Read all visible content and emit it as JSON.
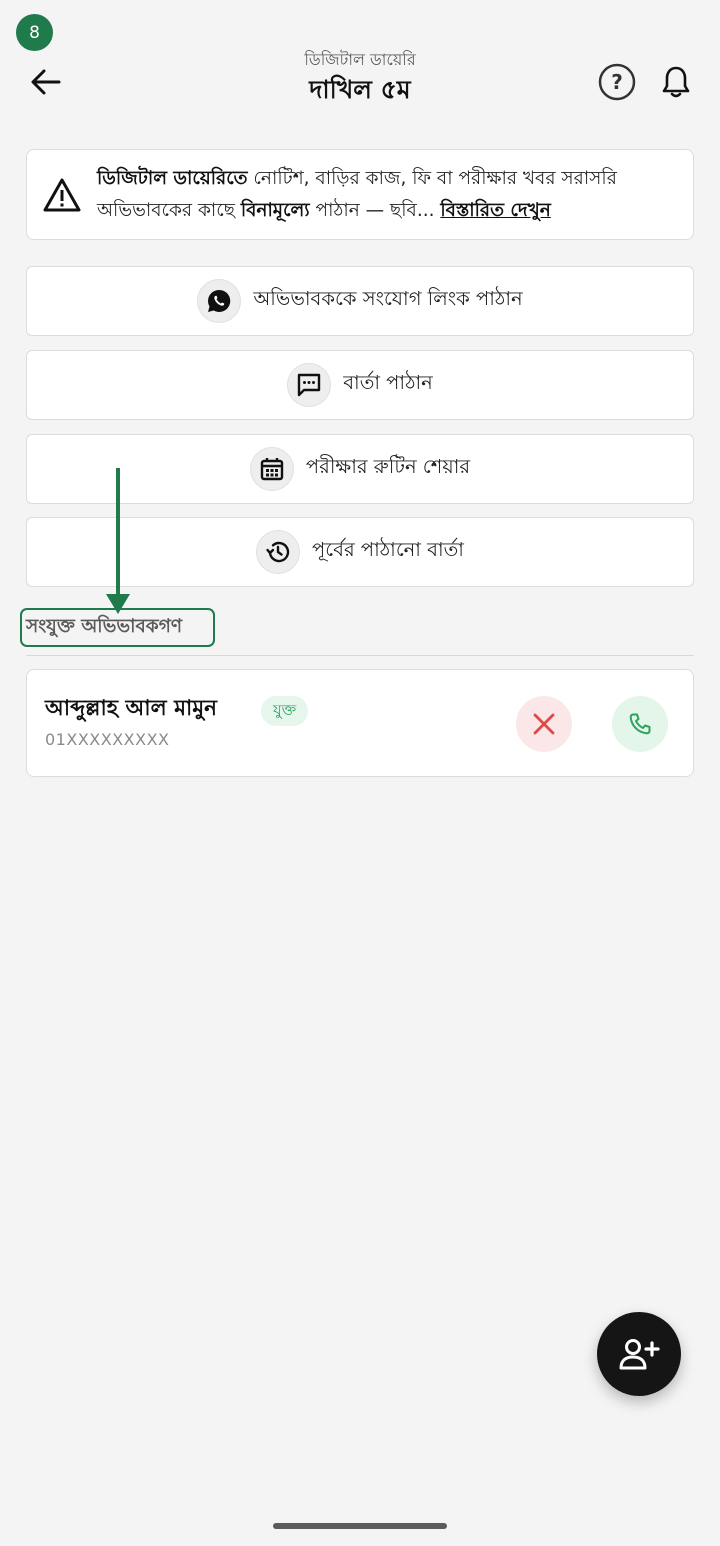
{
  "step_badge": "8",
  "header": {
    "subtitle": "ডিজিটাল ডায়েরি",
    "title": "দাখিল ৫ম"
  },
  "notice": {
    "bold_lead": "ডিজিটাল ডায়েরিতে",
    "text_1": " নোটিশ, বাড়ির কাজ, ফি বা পরীক্ষার খবর সরাসরি অভিভাবকের কাছে ",
    "bold_mid": "বিনামূল্যে",
    "text_2": " পাঠান — ছবি... ",
    "link": "বিস্তারিত দেখুন"
  },
  "actions": [
    {
      "label": "অভিভাবককে সংযোগ লিংক পাঠান",
      "icon": "whatsapp-icon"
    },
    {
      "label": "বার্তা পাঠান",
      "icon": "message-icon"
    },
    {
      "label": "পরীক্ষার রুটিন শেয়ার",
      "icon": "calendar-icon"
    },
    {
      "label": "পূর্বের পাঠানো বার্তা",
      "icon": "history-icon"
    }
  ],
  "section": {
    "label": "সংযুক্ত অভিভাবকগণ"
  },
  "guardians": [
    {
      "name": "আব্দুল্লাহ আল মামুন",
      "status": "যুক্ত",
      "phone": "01XXXXXXXXX"
    }
  ],
  "colors": {
    "accent": "#1f7a4c",
    "status_green": "#2aa35c",
    "remove_red": "#e04848",
    "fab": "#151515"
  }
}
